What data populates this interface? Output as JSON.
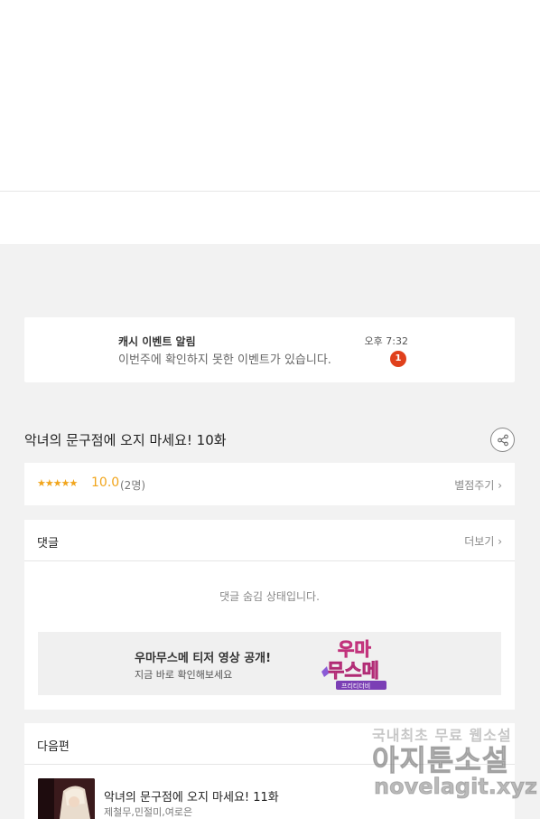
{
  "notification": {
    "title": "캐시 이벤트 알림",
    "body": "이번주에 확인하지 못한 이벤트가 있습니다.",
    "time": "오후 7:32",
    "badge": "1"
  },
  "episode": {
    "title": "악녀의 문구점에 오지 마세요! 10화",
    "share_icon": "share-icon"
  },
  "rating": {
    "stars": "★★★★★",
    "score": "10.0",
    "count": "(2명)",
    "rate_link": "별점주기 ›"
  },
  "comments": {
    "title": "댓글",
    "more": "더보기 ›",
    "hidden_message": "댓글 숨김 상태입니다."
  },
  "promo": {
    "title": "우마무스메 티저 영상 공개!",
    "subtitle": "지금 바로 확인해보세요",
    "logo_text": "우마무스메",
    "logo_sub": "프리티더비"
  },
  "next": {
    "title": "다음편",
    "episode_title": "악녀의 문구점에 오지 마세요! 11화",
    "authors": "제철무,민절미,여로은"
  },
  "watermark": {
    "line1": "국내최초 무료 웹소설",
    "line2": "아지툰소설",
    "line3": "novelagit.xyz"
  }
}
